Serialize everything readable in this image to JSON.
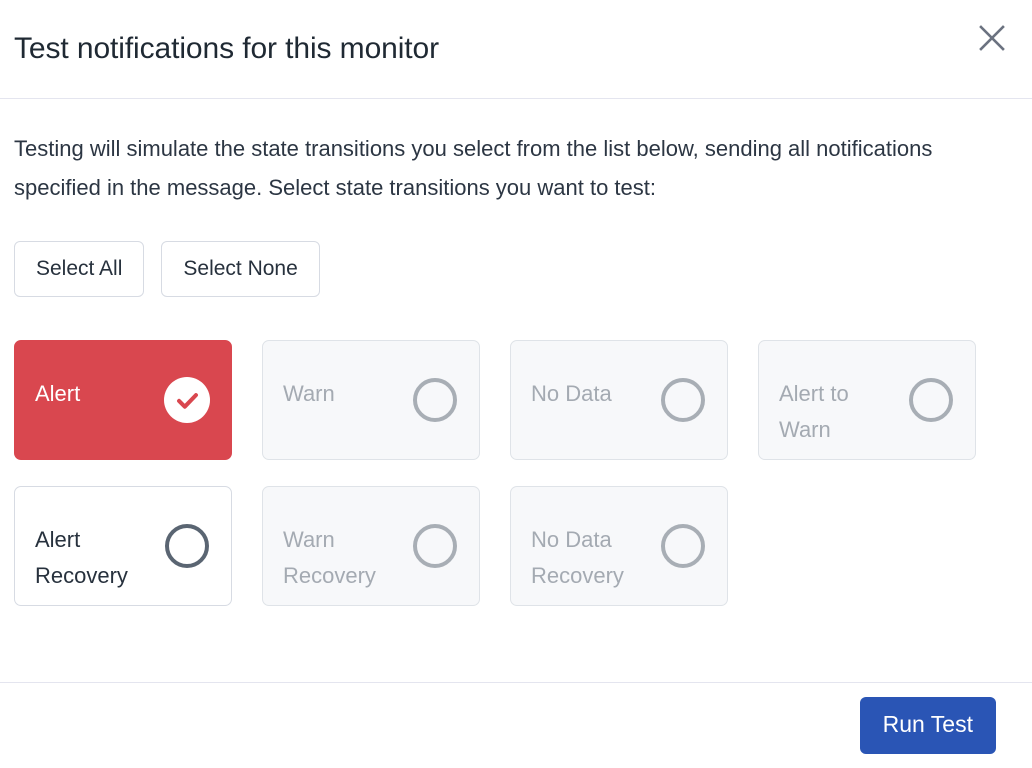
{
  "dialog": {
    "title": "Test notifications for this monitor",
    "close_icon": "close-icon",
    "intro": "Testing will simulate the state transitions you select from the list below, sending all notifications specified in the message. Select state transitions you want to test:",
    "select_all_label": "Select All",
    "select_none_label": "Select None",
    "run_test_label": "Run Test"
  },
  "colors": {
    "selected_tile": "#d9474f",
    "primary_button": "#2a55b5",
    "tile_border": "#dfe3e8",
    "disabled_text": "#a4aab2",
    "enabled_text": "#27313d"
  },
  "transitions": {
    "rows": [
      [
        {
          "label": "Alert",
          "state": "selected"
        },
        {
          "label": "Warn",
          "state": "disabled"
        },
        {
          "label": "No Data",
          "state": "disabled"
        },
        {
          "label": "Alert to Warn",
          "state": "disabled"
        }
      ],
      [
        {
          "label": "Alert Recovery",
          "state": "enabled"
        },
        {
          "label": "Warn Recovery",
          "state": "disabled"
        },
        {
          "label": "No Data Recovery",
          "state": "disabled"
        }
      ]
    ]
  }
}
